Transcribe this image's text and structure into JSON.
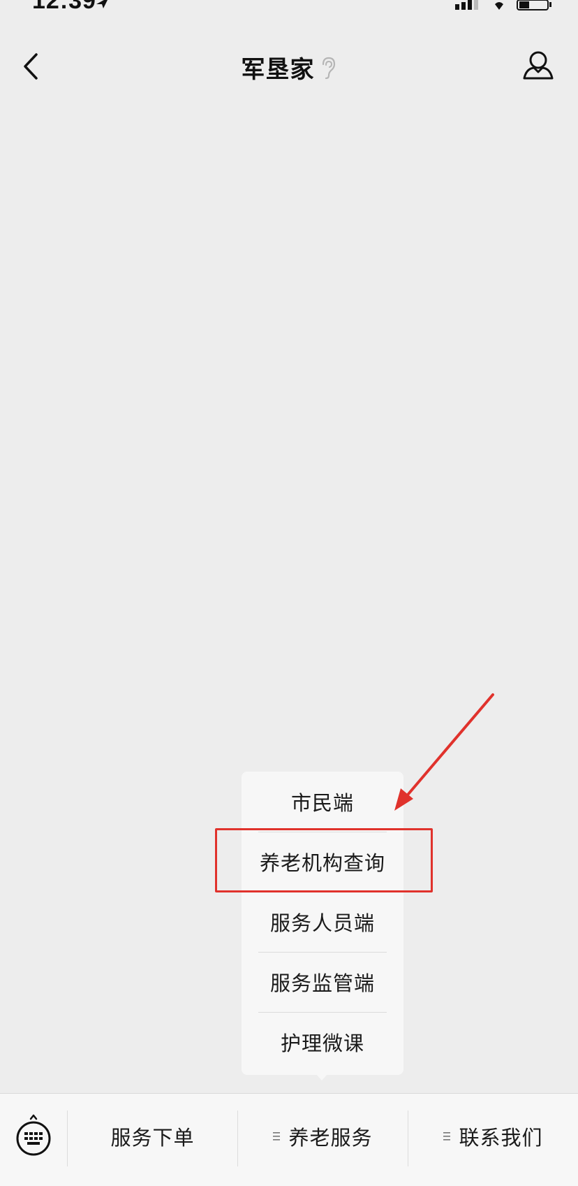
{
  "status_bar": {
    "time": "12:39"
  },
  "nav": {
    "title": "军垦家"
  },
  "popup_menu": {
    "items": [
      "市民端",
      "养老机构查询",
      "服务人员端",
      "服务监管端",
      "护理微课"
    ]
  },
  "bottom_menu": {
    "items": [
      {
        "label": "服务下单",
        "has_submenu": false
      },
      {
        "label": "养老服务",
        "has_submenu": true
      },
      {
        "label": "联系我们",
        "has_submenu": true
      }
    ]
  },
  "annotation": {
    "color": "#e0322c",
    "highlighted_item": "养老机构查询"
  }
}
